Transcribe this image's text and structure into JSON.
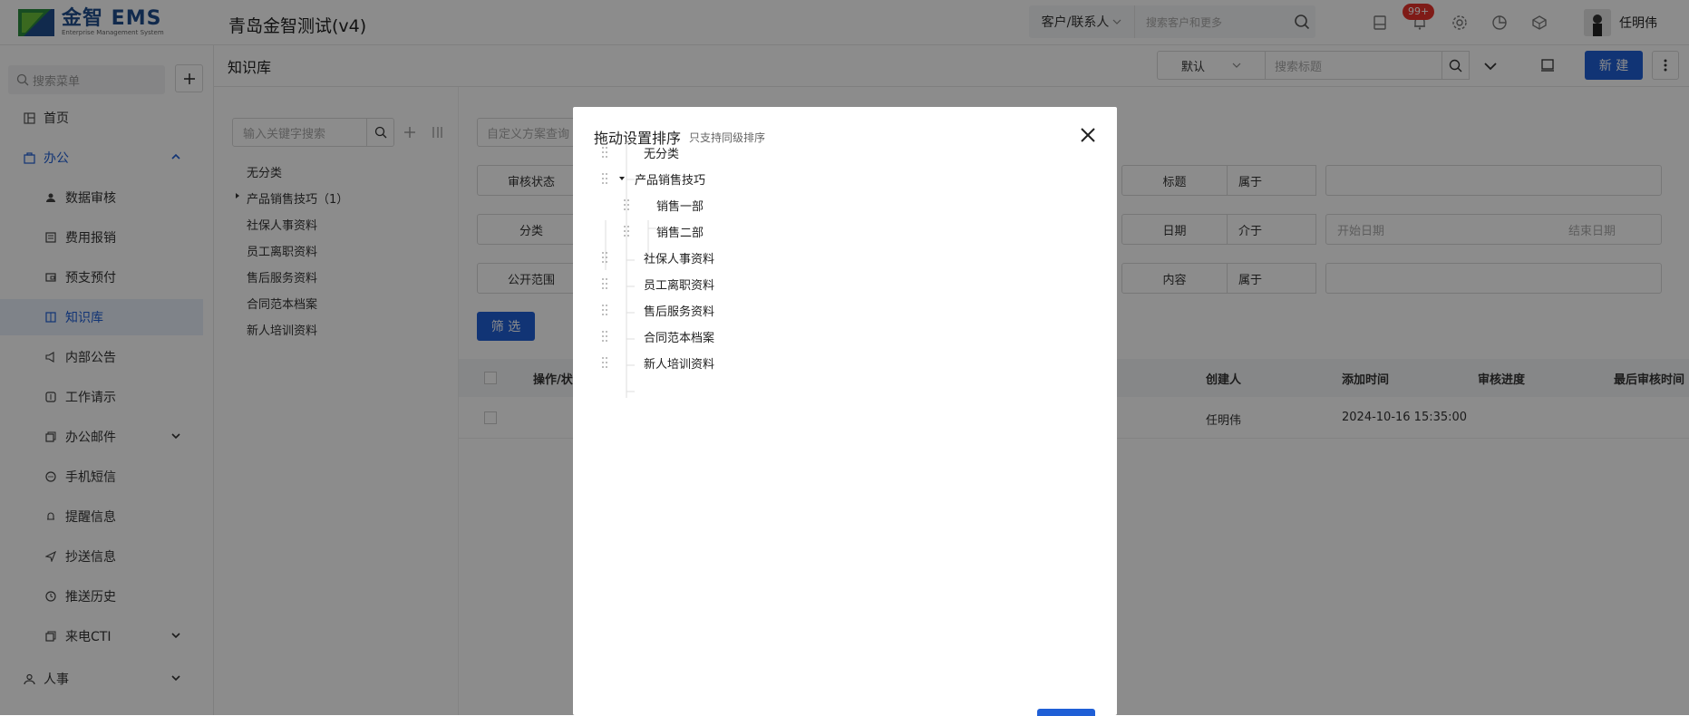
{
  "header": {
    "logo_title": "金智 EMS",
    "logo_subtitle": "Enterprise Management System",
    "company": "青岛金智测试(v4)",
    "search_scope": "客户/联系人",
    "search_placeholder": "搜索客户和更多",
    "notification_badge": "99+",
    "user_name": "任明伟"
  },
  "sidebar": {
    "search_placeholder": "搜索菜单",
    "items": [
      {
        "label": "首页",
        "icon": "dashboard-icon"
      },
      {
        "label": "办公",
        "icon": "briefcase-icon"
      },
      {
        "label": "数据审核",
        "icon": "user-check-icon"
      },
      {
        "label": "费用报销",
        "icon": "receipt-icon"
      },
      {
        "label": "预支预付",
        "icon": "wallet-icon"
      },
      {
        "label": "知识库",
        "icon": "book-icon"
      },
      {
        "label": "内部公告",
        "icon": "megaphone-icon"
      },
      {
        "label": "工作请示",
        "icon": "request-icon"
      },
      {
        "label": "办公邮件",
        "icon": "mail-icon"
      },
      {
        "label": "手机短信",
        "icon": "sms-icon"
      },
      {
        "label": "提醒信息",
        "icon": "bell-icon"
      },
      {
        "label": "抄送信息",
        "icon": "send-icon"
      },
      {
        "label": "推送历史",
        "icon": "clock-icon"
      },
      {
        "label": "来电CTI",
        "icon": "phone-icon"
      },
      {
        "label": "人事",
        "icon": "people-icon"
      }
    ]
  },
  "page": {
    "title": "知识库",
    "view_select": "默认",
    "title_search_placeholder": "搜索标题",
    "new_button": "新 建"
  },
  "tree": {
    "search_placeholder": "输入关键字搜索",
    "nodes": [
      "无分类",
      "产品销售技巧（1）",
      "社保人事资料",
      "员工离职资料",
      "售后服务资料",
      "合同范本档案",
      "新人培训资料"
    ]
  },
  "filters": {
    "custom_scheme_placeholder": "自定义方案查询",
    "left_labels": [
      "审核状态",
      "分类",
      "公开范围"
    ],
    "right_labels": [
      "标题",
      "日期",
      "内容"
    ],
    "ops": [
      "属于",
      "介于",
      "属于"
    ],
    "date_start": "开始日期",
    "date_end": "结束日期",
    "filter_button": "筛 选"
  },
  "table": {
    "headers": [
      "操作/状",
      "创建人",
      "添加时间",
      "审核进度",
      "最后审核时间"
    ],
    "row": {
      "creator": "任明伟",
      "added": "2024-10-16 15:35:00"
    }
  },
  "modal": {
    "title": "拖动设置排序",
    "hint": "只支持同级排序",
    "items": [
      {
        "label": "无分类",
        "level": 0
      },
      {
        "label": "产品销售技巧",
        "level": 0,
        "expanded": true
      },
      {
        "label": "销售一部",
        "level": 1
      },
      {
        "label": "销售二部",
        "level": 1
      },
      {
        "label": "社保人事资料",
        "level": 0
      },
      {
        "label": "员工离职资料",
        "level": 0
      },
      {
        "label": "售后服务资料",
        "level": 0
      },
      {
        "label": "合同范本档案",
        "level": 0
      },
      {
        "label": "新人培训资料",
        "level": 0
      }
    ]
  },
  "colors": {
    "accent": "#1f5fd6",
    "badge": "#e8322b"
  }
}
